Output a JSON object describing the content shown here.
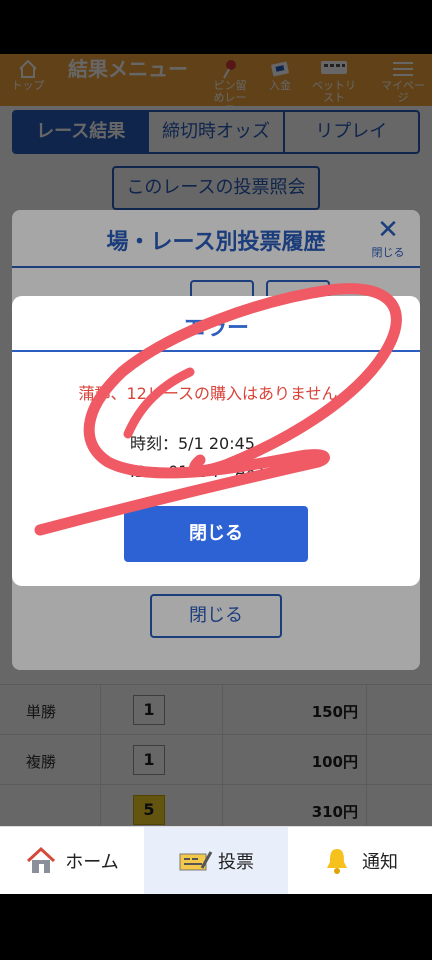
{
  "header": {
    "title": "結果メニュー",
    "items": [
      {
        "label": "トップ",
        "icon": "home-icon"
      },
      {
        "label": "ピン留めレース",
        "icon": "pin-icon"
      },
      {
        "label": "入金",
        "icon": "card-icon"
      },
      {
        "label": "ベットリスト",
        "icon": "list-icon"
      },
      {
        "label": "マイページ",
        "icon": "menu-icon"
      }
    ]
  },
  "tabs": [
    {
      "label": "レース結果",
      "active": true
    },
    {
      "label": "締切時オッズ",
      "active": false
    },
    {
      "label": "リプレイ",
      "active": false
    }
  ],
  "vote_query_label": "このレースの投票照会",
  "history_modal": {
    "title": "場・レース別投票履歴",
    "close_label": "閉じる",
    "close_button": "閉じる"
  },
  "error_modal": {
    "title": "エラー",
    "message": "蒲郡、12レースの購入はありません。",
    "time_label": "時刻：5/1 20:45",
    "id_label": "ID ：01694 - A81",
    "button": "閉じる"
  },
  "results": [
    {
      "type": "単勝",
      "number": "1",
      "amount": "150円",
      "highlight": false
    },
    {
      "type": "複勝",
      "number": "1",
      "amount": "100円",
      "highlight": false
    },
    {
      "type": "",
      "number": "5",
      "amount": "310円",
      "highlight": true
    }
  ],
  "bottom_nav": [
    {
      "label": "ホーム",
      "icon": "house-icon",
      "active": false
    },
    {
      "label": "投票",
      "icon": "ticket-icon",
      "active": true
    },
    {
      "label": "通知",
      "icon": "bell-icon",
      "active": false
    }
  ],
  "colors": {
    "header": "#f3a23b",
    "accent": "#2b5ebd",
    "error": "#d9443a",
    "scribble": "#ef5a64"
  }
}
